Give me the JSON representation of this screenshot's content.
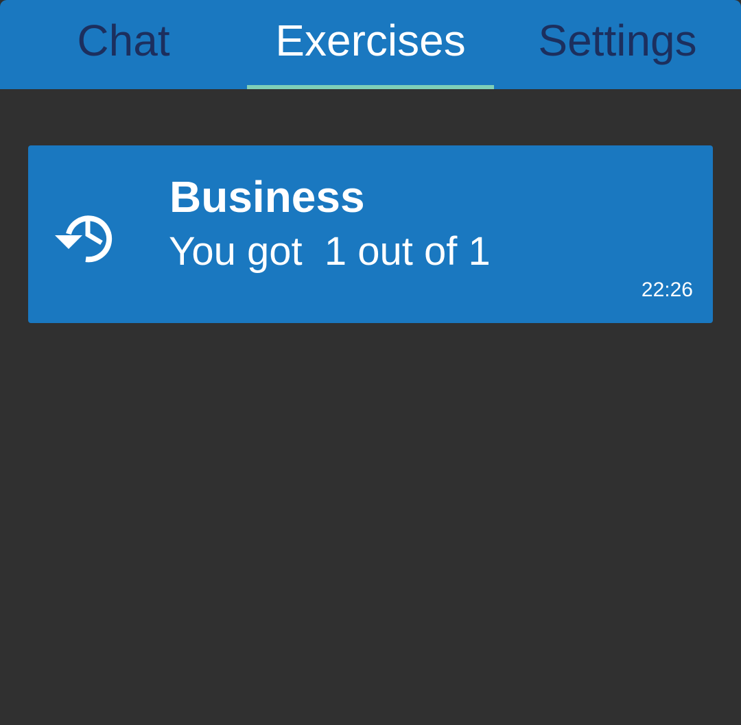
{
  "tabs": [
    {
      "label": "Chat",
      "active": false
    },
    {
      "label": "Exercises",
      "active": true
    },
    {
      "label": "Settings",
      "active": false
    }
  ],
  "exercise": {
    "icon": "history-icon",
    "title": "Business",
    "score_text": "You got  1 out of 1",
    "time": "22:26"
  },
  "colors": {
    "primary": "#1a78c0",
    "background": "#303030",
    "tab_inactive_text": "#1c2f5e",
    "tab_active_text": "#ffffff",
    "tab_indicator": "#7fcfb8"
  }
}
